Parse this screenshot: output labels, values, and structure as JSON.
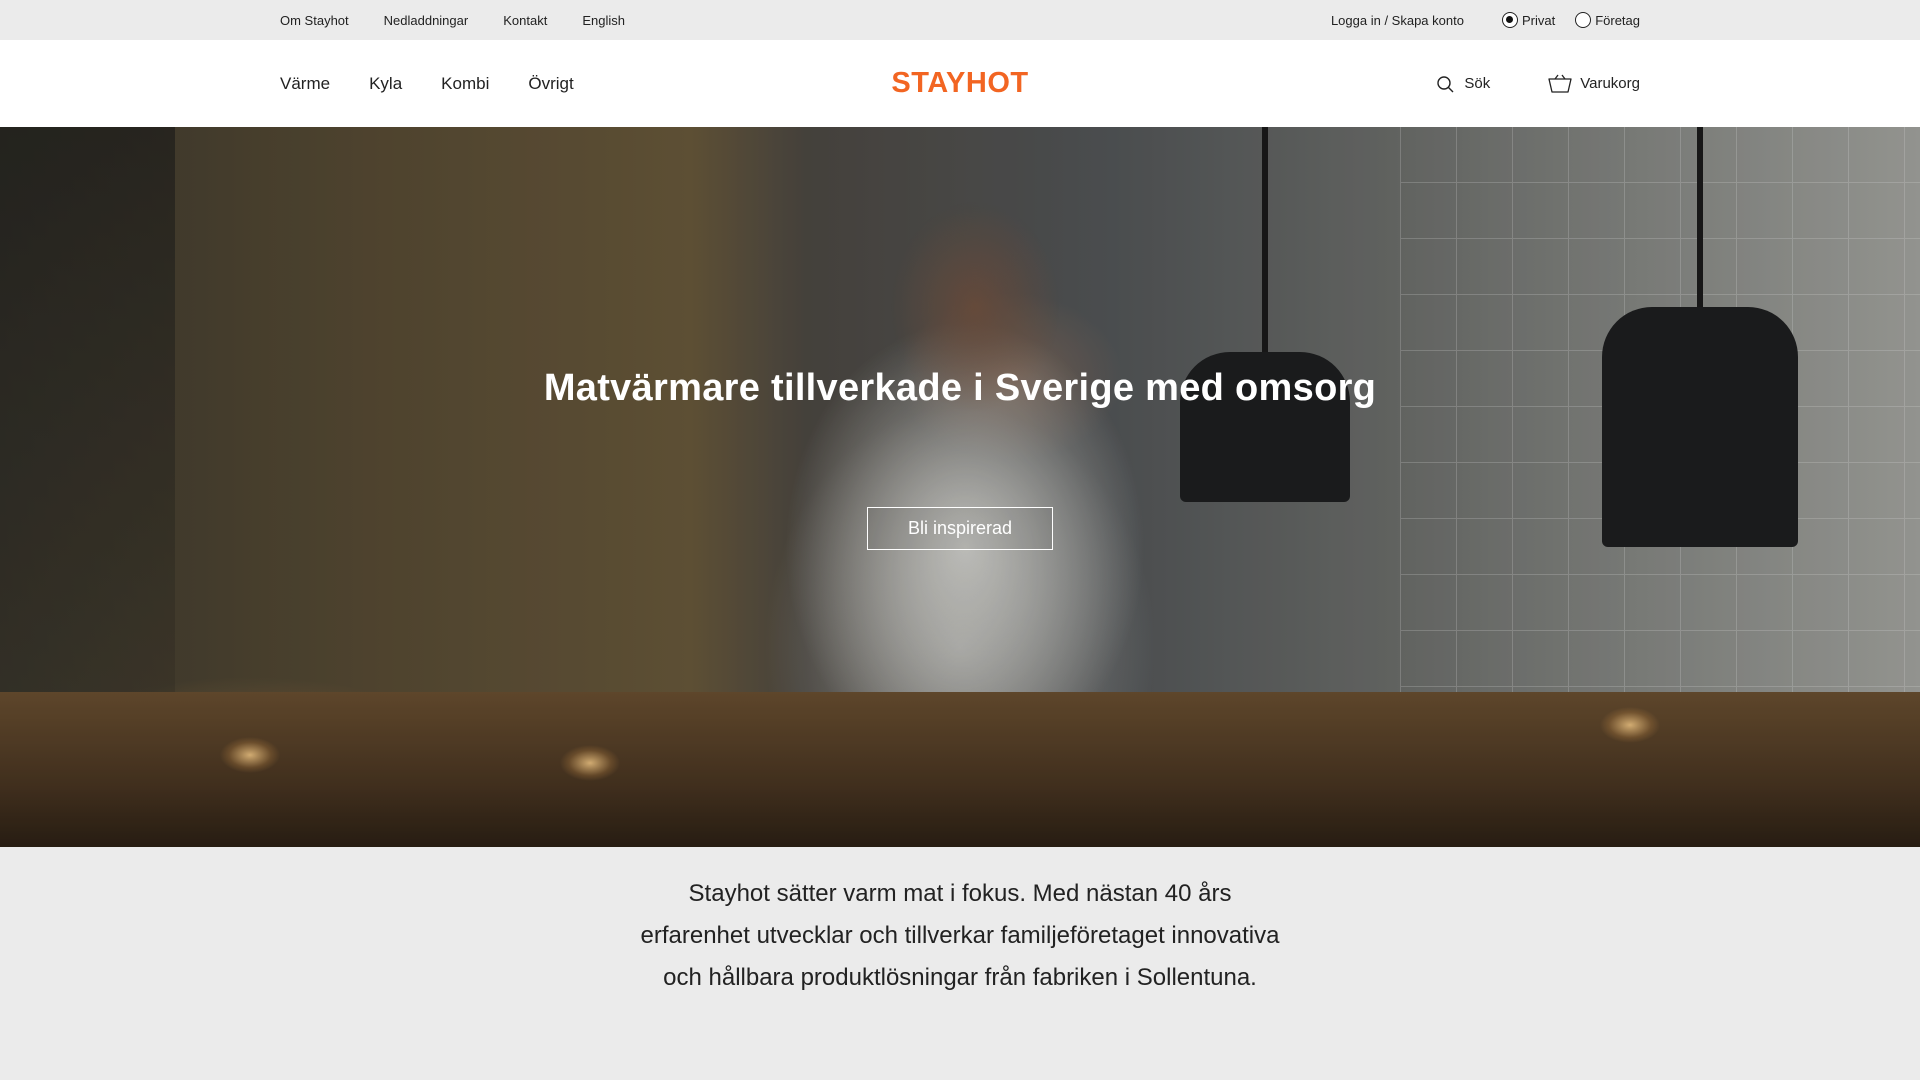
{
  "topbar": {
    "links": [
      "Om Stayhot",
      "Nedladdningar",
      "Kontakt",
      "English"
    ],
    "login": "Logga in / Skapa konto",
    "customer_type": {
      "options": [
        "Privat",
        "Företag"
      ],
      "selected": "Privat"
    }
  },
  "header": {
    "nav": [
      "Värme",
      "Kyla",
      "Kombi",
      "Övrigt"
    ],
    "logo": "STAYHOT",
    "search_label": "Sök",
    "cart_label": "Varukorg",
    "search_icon": "search-icon",
    "cart_icon": "basket-icon"
  },
  "hero": {
    "title": "Matvärmare tillverkade i Sverige med omsorg",
    "button": "Bli inspirerad"
  },
  "intro": {
    "text": "Stayhot sätter varm mat i fokus. Med nästan 40 års erfarenhet utvecklar och tillverkar familjeföretaget innovativa och hållbara produktlösningar från fabriken i Sollentuna."
  },
  "colors": {
    "brand": "#f26522",
    "background": "#ebebeb",
    "header": "#ffffff"
  }
}
